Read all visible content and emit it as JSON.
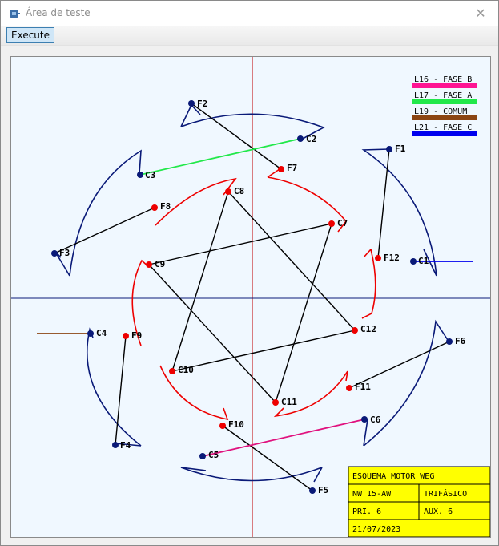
{
  "window": {
    "title": "Área de teste",
    "close_glyph": "✕",
    "app_icon": "gear-app-icon"
  },
  "toolbar": {
    "execute_label": "Execute"
  },
  "legend": [
    {
      "label": "L16 - FASE B",
      "color": "#ff1493"
    },
    {
      "label": "L17 - FASE A",
      "color": "#22e84a"
    },
    {
      "label": "L19 - COMUM",
      "color": "#8b4513"
    },
    {
      "label": "L21 - FASE C",
      "color": "#0000ee"
    }
  ],
  "title_block": {
    "heading": "ESQUEMA MOTOR WEG",
    "model": "NW 15-AW",
    "phase": "TRIFÁSICO",
    "pri": "PRI. 6",
    "aux": "AUX. 6",
    "date": "21/07/2023"
  },
  "terminals": {
    "outer": [
      "F2",
      "C2",
      "F1",
      "C3",
      "F3",
      "C1",
      "C4",
      "F6",
      "F4",
      "C6",
      "C5",
      "F5"
    ],
    "inner": [
      "F7",
      "C8",
      "C7",
      "F8",
      "C9",
      "F12",
      "F9",
      "C12",
      "C10",
      "F11",
      "C11",
      "F10"
    ]
  },
  "colors": {
    "outer_coil": "#0a1a78",
    "inner_coil": "#ee0000",
    "outer_dot": "#0a1a78",
    "inner_dot": "#ee0000",
    "crosshair_v": "#c00000",
    "crosshair_h": "#0a1a78",
    "title_block_bg": "#ffff00"
  }
}
